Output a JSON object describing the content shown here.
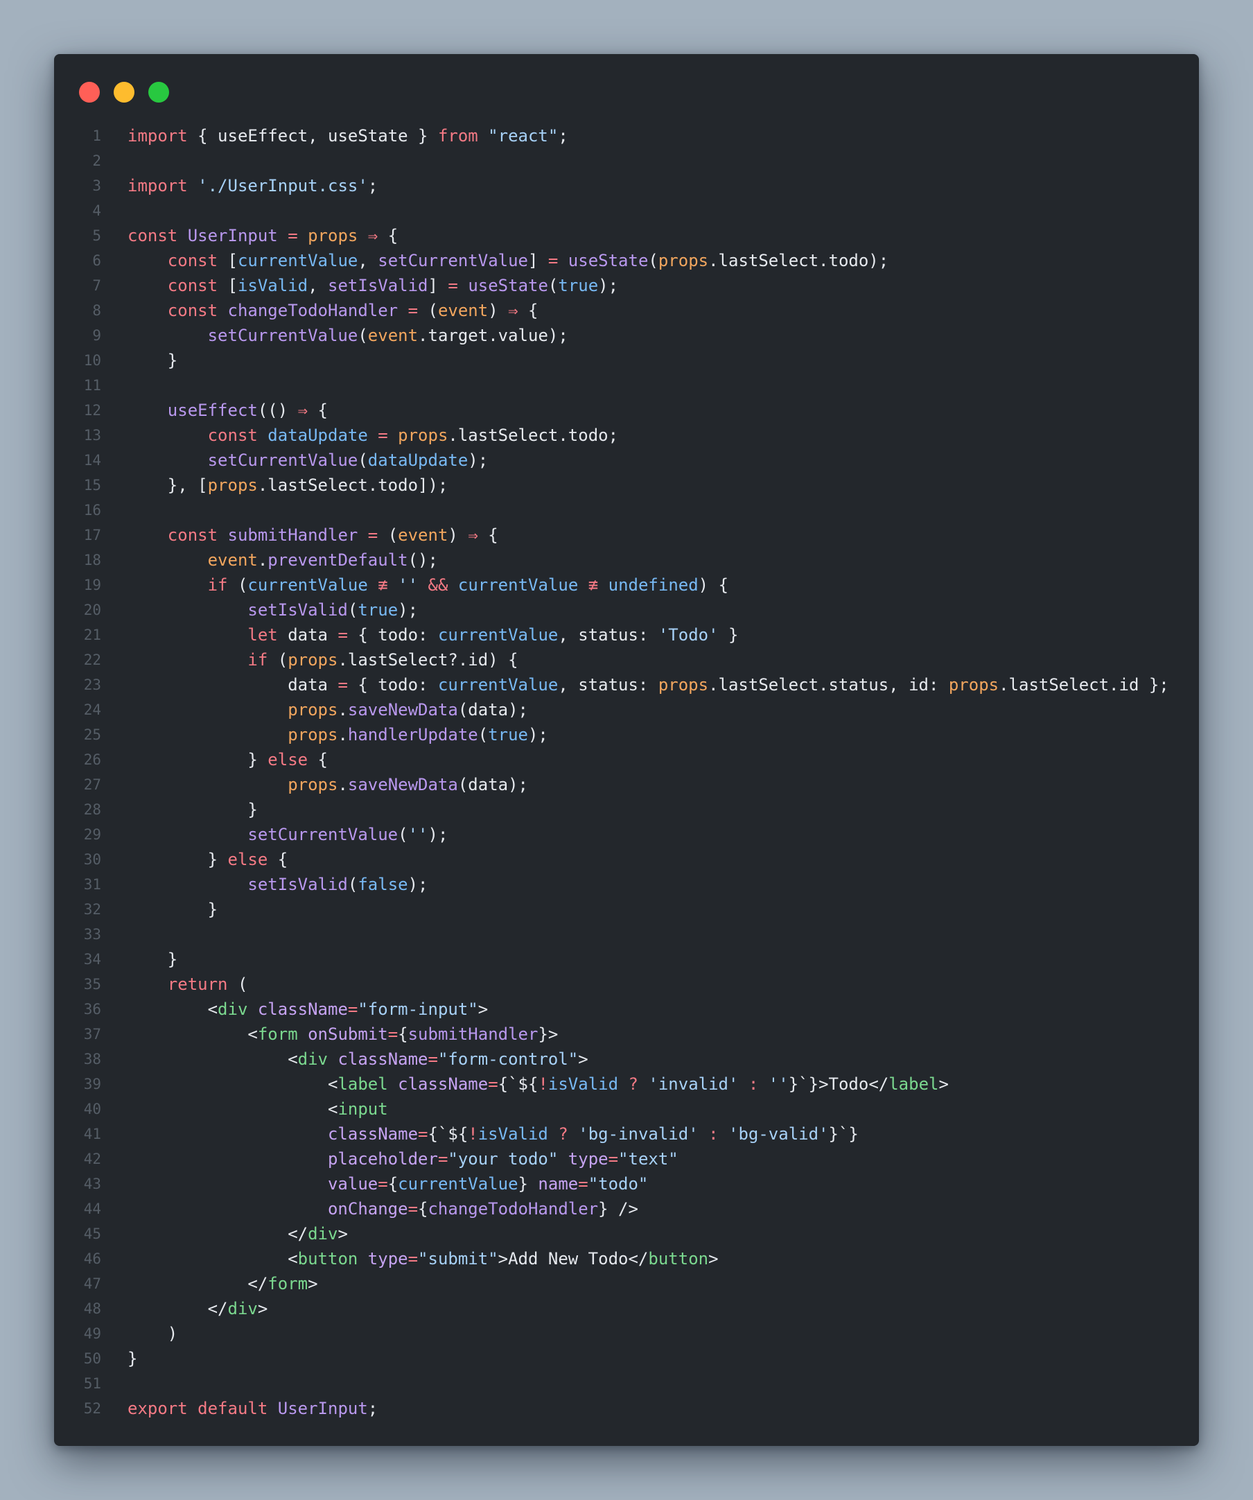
{
  "window": {
    "buttons": [
      {
        "name": "close-button",
        "color": "#ff5f57"
      },
      {
        "name": "minimize-button",
        "color": "#febc2e"
      },
      {
        "name": "maximize-button",
        "color": "#28c840"
      }
    ]
  },
  "theme": {
    "background": "#23272c",
    "page_background": "#a3b1be",
    "keyword": "#f47a85",
    "function": "#b998ee",
    "variable": "#78b9f4",
    "string": "#a7d1f7",
    "param": "#f2a65e",
    "tag": "#7bd88f",
    "attribute": "#c6a3f2",
    "plain": "#e6e9ee",
    "line_number": "#555d66"
  },
  "code": {
    "language": "jsx",
    "lines": [
      [
        [
          "kw",
          "import"
        ],
        [
          "pl",
          " { useEffect, useState } "
        ],
        [
          "kw",
          "from"
        ],
        [
          "st",
          " \"react\""
        ],
        [
          "pl",
          ";"
        ]
      ],
      [],
      [
        [
          "kw",
          "import"
        ],
        [
          "st",
          " './UserInput.css'"
        ],
        [
          "pl",
          ";"
        ]
      ],
      [],
      [
        [
          "kw",
          "const"
        ],
        [
          "fn",
          " UserInput"
        ],
        [
          "kw",
          " ="
        ],
        [
          "pr",
          " props"
        ],
        [
          "kw",
          " ⇒"
        ],
        [
          "pl",
          " {"
        ]
      ],
      [
        [
          "pl",
          "    "
        ],
        [
          "kw",
          "const"
        ],
        [
          "pl",
          " ["
        ],
        [
          "vr",
          "currentValue"
        ],
        [
          "pl",
          ", "
        ],
        [
          "fn",
          "setCurrentValue"
        ],
        [
          "pl",
          "] "
        ],
        [
          "kw",
          "="
        ],
        [
          "fn",
          " useState"
        ],
        [
          "pl",
          "("
        ],
        [
          "pr",
          "props"
        ],
        [
          "pl",
          ".lastSelect.todo);"
        ]
      ],
      [
        [
          "pl",
          "    "
        ],
        [
          "kw",
          "const"
        ],
        [
          "pl",
          " ["
        ],
        [
          "vr",
          "isValid"
        ],
        [
          "pl",
          ", "
        ],
        [
          "fn",
          "setIsValid"
        ],
        [
          "pl",
          "] "
        ],
        [
          "kw",
          "="
        ],
        [
          "fn",
          " useState"
        ],
        [
          "pl",
          "("
        ],
        [
          "vr",
          "true"
        ],
        [
          "pl",
          ");"
        ]
      ],
      [
        [
          "pl",
          "    "
        ],
        [
          "kw",
          "const"
        ],
        [
          "fn",
          " changeTodoHandler"
        ],
        [
          "kw",
          " ="
        ],
        [
          "pl",
          " ("
        ],
        [
          "pr",
          "event"
        ],
        [
          "pl",
          ") "
        ],
        [
          "kw",
          "⇒"
        ],
        [
          "pl",
          " {"
        ]
      ],
      [
        [
          "pl",
          "        "
        ],
        [
          "fn",
          "setCurrentValue"
        ],
        [
          "pl",
          "("
        ],
        [
          "pr",
          "event"
        ],
        [
          "pl",
          ".target.value);"
        ]
      ],
      [
        [
          "pl",
          "    }"
        ]
      ],
      [],
      [
        [
          "pl",
          "    "
        ],
        [
          "fn",
          "useEffect"
        ],
        [
          "pl",
          "(() "
        ],
        [
          "kw",
          "⇒"
        ],
        [
          "pl",
          " {"
        ]
      ],
      [
        [
          "pl",
          "        "
        ],
        [
          "kw",
          "const"
        ],
        [
          "vr",
          " dataUpdate"
        ],
        [
          "kw",
          " ="
        ],
        [
          "pr",
          " props"
        ],
        [
          "pl",
          ".lastSelect.todo;"
        ]
      ],
      [
        [
          "pl",
          "        "
        ],
        [
          "fn",
          "setCurrentValue"
        ],
        [
          "pl",
          "("
        ],
        [
          "vr",
          "dataUpdate"
        ],
        [
          "pl",
          ");"
        ]
      ],
      [
        [
          "pl",
          "    }, ["
        ],
        [
          "pr",
          "props"
        ],
        [
          "pl",
          ".lastSelect.todo]);"
        ]
      ],
      [],
      [
        [
          "pl",
          "    "
        ],
        [
          "kw",
          "const"
        ],
        [
          "fn",
          " submitHandler"
        ],
        [
          "kw",
          " ="
        ],
        [
          "pl",
          " ("
        ],
        [
          "pr",
          "event"
        ],
        [
          "pl",
          ") "
        ],
        [
          "kw",
          "⇒"
        ],
        [
          "pl",
          " {"
        ]
      ],
      [
        [
          "pl",
          "        "
        ],
        [
          "pr",
          "event"
        ],
        [
          "pl",
          "."
        ],
        [
          "fn",
          "preventDefault"
        ],
        [
          "pl",
          "();"
        ]
      ],
      [
        [
          "pl",
          "        "
        ],
        [
          "kw",
          "if"
        ],
        [
          "pl",
          " ("
        ],
        [
          "vr",
          "currentValue"
        ],
        [
          "kw",
          " ≢"
        ],
        [
          "st",
          " ''"
        ],
        [
          "kw",
          " &&"
        ],
        [
          "vr",
          " currentValue"
        ],
        [
          "kw",
          " ≢"
        ],
        [
          "vr",
          " undefined"
        ],
        [
          "pl",
          ") {"
        ]
      ],
      [
        [
          "pl",
          "            "
        ],
        [
          "fn",
          "setIsValid"
        ],
        [
          "pl",
          "("
        ],
        [
          "vr",
          "true"
        ],
        [
          "pl",
          ");"
        ]
      ],
      [
        [
          "pl",
          "            "
        ],
        [
          "kw",
          "let"
        ],
        [
          "pl",
          " data "
        ],
        [
          "kw",
          "="
        ],
        [
          "pl",
          " { todo: "
        ],
        [
          "vr",
          "currentValue"
        ],
        [
          "pl",
          ", status: "
        ],
        [
          "st",
          "'Todo'"
        ],
        [
          "pl",
          " }"
        ]
      ],
      [
        [
          "pl",
          "            "
        ],
        [
          "kw",
          "if"
        ],
        [
          "pl",
          " ("
        ],
        [
          "pr",
          "props"
        ],
        [
          "pl",
          ".lastSelect?.id) {"
        ]
      ],
      [
        [
          "pl",
          "                data "
        ],
        [
          "kw",
          "="
        ],
        [
          "pl",
          " { todo: "
        ],
        [
          "vr",
          "currentValue"
        ],
        [
          "pl",
          ", status: "
        ],
        [
          "pr",
          "props"
        ],
        [
          "pl",
          ".lastSelect.status, id: "
        ],
        [
          "pr",
          "props"
        ],
        [
          "pl",
          ".lastSelect.id };"
        ]
      ],
      [
        [
          "pl",
          "                "
        ],
        [
          "pr",
          "props"
        ],
        [
          "pl",
          "."
        ],
        [
          "fn",
          "saveNewData"
        ],
        [
          "pl",
          "(data);"
        ]
      ],
      [
        [
          "pl",
          "                "
        ],
        [
          "pr",
          "props"
        ],
        [
          "pl",
          "."
        ],
        [
          "fn",
          "handlerUpdate"
        ],
        [
          "pl",
          "("
        ],
        [
          "vr",
          "true"
        ],
        [
          "pl",
          ");"
        ]
      ],
      [
        [
          "pl",
          "            } "
        ],
        [
          "kw",
          "else"
        ],
        [
          "pl",
          " {"
        ]
      ],
      [
        [
          "pl",
          "                "
        ],
        [
          "pr",
          "props"
        ],
        [
          "pl",
          "."
        ],
        [
          "fn",
          "saveNewData"
        ],
        [
          "pl",
          "(data);"
        ]
      ],
      [
        [
          "pl",
          "            }"
        ]
      ],
      [
        [
          "pl",
          "            "
        ],
        [
          "fn",
          "setCurrentValue"
        ],
        [
          "pl",
          "("
        ],
        [
          "st",
          "''"
        ],
        [
          "pl",
          ");"
        ]
      ],
      [
        [
          "pl",
          "        } "
        ],
        [
          "kw",
          "else"
        ],
        [
          "pl",
          " {"
        ]
      ],
      [
        [
          "pl",
          "            "
        ],
        [
          "fn",
          "setIsValid"
        ],
        [
          "pl",
          "("
        ],
        [
          "vr",
          "false"
        ],
        [
          "pl",
          ");"
        ]
      ],
      [
        [
          "pl",
          "        }"
        ]
      ],
      [],
      [
        [
          "pl",
          "    }"
        ]
      ],
      [
        [
          "pl",
          "    "
        ],
        [
          "kw",
          "return"
        ],
        [
          "pl",
          " ("
        ]
      ],
      [
        [
          "pl",
          "        <"
        ],
        [
          "tg",
          "div"
        ],
        [
          "at",
          " className"
        ],
        [
          "kw",
          "="
        ],
        [
          "st",
          "\"form-input\""
        ],
        [
          "pl",
          ">"
        ]
      ],
      [
        [
          "pl",
          "            <"
        ],
        [
          "tg",
          "form"
        ],
        [
          "at",
          " onSubmit"
        ],
        [
          "kw",
          "="
        ],
        [
          "pl",
          "{"
        ],
        [
          "fn",
          "submitHandler"
        ],
        [
          "pl",
          "}>"
        ]
      ],
      [
        [
          "pl",
          "                <"
        ],
        [
          "tg",
          "div"
        ],
        [
          "at",
          " className"
        ],
        [
          "kw",
          "="
        ],
        [
          "st",
          "\"form-control\""
        ],
        [
          "pl",
          ">"
        ]
      ],
      [
        [
          "pl",
          "                    <"
        ],
        [
          "tg",
          "label"
        ],
        [
          "at",
          " className"
        ],
        [
          "kw",
          "="
        ],
        [
          "pl",
          "{`${"
        ],
        [
          "kw",
          "!"
        ],
        [
          "vr",
          "isValid"
        ],
        [
          "kw",
          " ?"
        ],
        [
          "st",
          " 'invalid'"
        ],
        [
          "kw",
          " :"
        ],
        [
          "st",
          " ''"
        ],
        [
          "pl",
          "}`}>Todo</"
        ],
        [
          "tg",
          "label"
        ],
        [
          "pl",
          ">"
        ]
      ],
      [
        [
          "pl",
          "                    <"
        ],
        [
          "tg",
          "input"
        ]
      ],
      [
        [
          "pl",
          "                    "
        ],
        [
          "at",
          "className"
        ],
        [
          "kw",
          "="
        ],
        [
          "pl",
          "{`${"
        ],
        [
          "kw",
          "!"
        ],
        [
          "vr",
          "isValid"
        ],
        [
          "kw",
          " ?"
        ],
        [
          "st",
          " 'bg-invalid'"
        ],
        [
          "kw",
          " :"
        ],
        [
          "st",
          " 'bg-valid'"
        ],
        [
          "pl",
          "}`}"
        ]
      ],
      [
        [
          "pl",
          "                    "
        ],
        [
          "at",
          "placeholder"
        ],
        [
          "kw",
          "="
        ],
        [
          "st",
          "\"your todo\""
        ],
        [
          "at",
          " type"
        ],
        [
          "kw",
          "="
        ],
        [
          "st",
          "\"text\""
        ]
      ],
      [
        [
          "pl",
          "                    "
        ],
        [
          "at",
          "value"
        ],
        [
          "kw",
          "="
        ],
        [
          "pl",
          "{"
        ],
        [
          "vr",
          "currentValue"
        ],
        [
          "pl",
          "}"
        ],
        [
          "at",
          " name"
        ],
        [
          "kw",
          "="
        ],
        [
          "st",
          "\"todo\""
        ]
      ],
      [
        [
          "pl",
          "                    "
        ],
        [
          "at",
          "onChange"
        ],
        [
          "kw",
          "="
        ],
        [
          "pl",
          "{"
        ],
        [
          "fn",
          "changeTodoHandler"
        ],
        [
          "pl",
          "} />"
        ]
      ],
      [
        [
          "pl",
          "                </"
        ],
        [
          "tg",
          "div"
        ],
        [
          "pl",
          ">"
        ]
      ],
      [
        [
          "pl",
          "                <"
        ],
        [
          "tg",
          "button"
        ],
        [
          "at",
          " type"
        ],
        [
          "kw",
          "="
        ],
        [
          "st",
          "\"submit\""
        ],
        [
          "pl",
          ">Add New Todo</"
        ],
        [
          "tg",
          "button"
        ],
        [
          "pl",
          ">"
        ]
      ],
      [
        [
          "pl",
          "            </"
        ],
        [
          "tg",
          "form"
        ],
        [
          "pl",
          ">"
        ]
      ],
      [
        [
          "pl",
          "        </"
        ],
        [
          "tg",
          "div"
        ],
        [
          "pl",
          ">"
        ]
      ],
      [
        [
          "pl",
          "    )"
        ]
      ],
      [
        [
          "pl",
          "}"
        ]
      ],
      [],
      [
        [
          "kw",
          "export"
        ],
        [
          "kw",
          " default"
        ],
        [
          "fn",
          " UserInput"
        ],
        [
          "pl",
          ";"
        ]
      ]
    ]
  }
}
